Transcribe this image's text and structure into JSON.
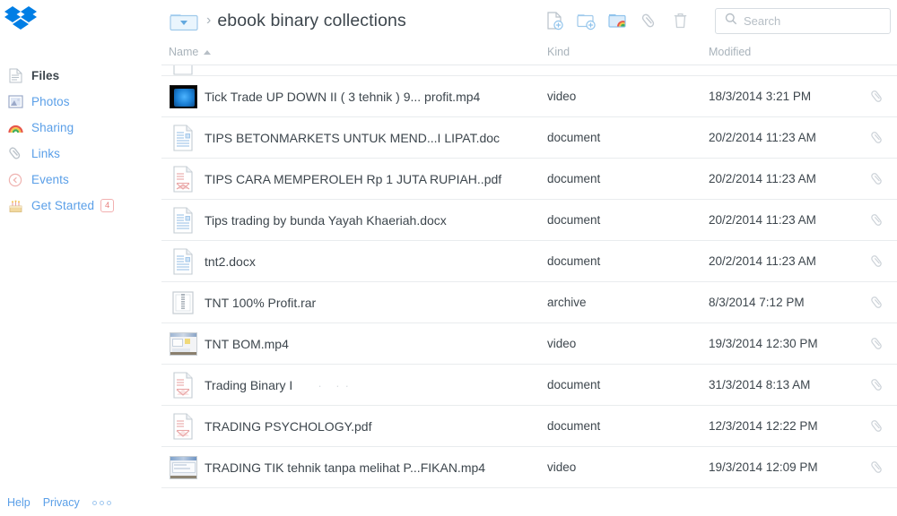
{
  "app": {
    "name": "Dropbox",
    "logo_icon": "dropbox-logo-icon"
  },
  "sidebar": {
    "items": [
      {
        "label": "Files",
        "icon": "files-icon",
        "active": true,
        "badge": null
      },
      {
        "label": "Photos",
        "icon": "photos-icon",
        "active": false,
        "badge": null
      },
      {
        "label": "Sharing",
        "icon": "sharing-icon",
        "active": false,
        "badge": null
      },
      {
        "label": "Links",
        "icon": "links-icon",
        "active": false,
        "badge": null
      },
      {
        "label": "Events",
        "icon": "events-icon",
        "active": false,
        "badge": null
      },
      {
        "label": "Get Started",
        "icon": "get-started-icon",
        "active": false,
        "badge": "4"
      }
    ],
    "footer": {
      "help": "Help",
      "privacy": "Privacy",
      "more_icon": "more-dots-icon"
    }
  },
  "header": {
    "folder_icon": "folder-dropdown-icon",
    "separator": "›",
    "breadcrumb": "ebook binary collections",
    "tools": [
      {
        "name": "upload-file-button",
        "icon": "file-plus-icon"
      },
      {
        "name": "new-folder-button",
        "icon": "folder-plus-icon"
      },
      {
        "name": "share-folder-button",
        "icon": "shared-folder-icon"
      },
      {
        "name": "get-link-button",
        "icon": "paperclip-icon"
      },
      {
        "name": "delete-button",
        "icon": "trash-icon"
      }
    ],
    "search": {
      "placeholder": "Search",
      "value": "",
      "icon": "search-icon"
    }
  },
  "table": {
    "columns": [
      {
        "key": "name",
        "label": "Name",
        "sorted": true,
        "sort_dir": "asc"
      },
      {
        "key": "kind",
        "label": "Kind",
        "sorted": false
      },
      {
        "key": "modified",
        "label": "Modified",
        "sorted": false
      }
    ],
    "link_icon": "paperclip-icon",
    "rows": [
      {
        "name": "",
        "kind": "",
        "modified": "",
        "icon": "document-icon",
        "partial": true
      },
      {
        "name": "Tick Trade UP DOWN II ( 3 tehnik ) 9... profit.mp4",
        "kind": "video",
        "modified": "18/3/2014 3:21 PM",
        "icon": "video-thumbnail-dark"
      },
      {
        "name": "TIPS BETONMARKETS UNTUK MEND...I LIPAT.doc",
        "kind": "document",
        "modified": "20/2/2014 11:23 AM",
        "icon": "doc-icon"
      },
      {
        "name": "TIPS CARA MEMPEROLEH Rp 1 JUTA RUPIAH..pdf",
        "kind": "document",
        "modified": "20/2/2014 11:23 AM",
        "icon": "pdf-icon"
      },
      {
        "name": "Tips trading by bunda Yayah Khaeriah.docx",
        "kind": "document",
        "modified": "20/2/2014 11:23 AM",
        "icon": "doc-icon"
      },
      {
        "name": "tnt2.docx",
        "kind": "document",
        "modified": "20/2/2014 11:23 AM",
        "icon": "doc-icon"
      },
      {
        "name": "TNT 100% Profit.rar",
        "kind": "archive",
        "modified": "8/3/2014 7:12 PM",
        "icon": "archive-icon"
      },
      {
        "name": "TNT BOM.mp4",
        "kind": "video",
        "modified": "19/3/2014 12:30 PM",
        "icon": "video-thumbnail-light"
      },
      {
        "name": "Trading Binary I",
        "name_fragment": "·  ··",
        "kind": "document",
        "modified": "31/3/2014 8:13 AM",
        "icon": "pdf-icon",
        "partially_rendered": true
      },
      {
        "name": "TRADING PSYCHOLOGY.pdf",
        "kind": "document",
        "modified": "12/3/2014 12:22 PM",
        "icon": "pdf-icon"
      },
      {
        "name": "TRADING TIK tehnik tanpa melihat P...FIKAN.mp4",
        "kind": "video",
        "modified": "19/3/2014 12:09 PM",
        "icon": "video-thumbnail-light"
      }
    ]
  },
  "colors": {
    "brand_blue": "#007ee5",
    "link_blue": "#5a9fe8",
    "text": "#3d464d",
    "muted": "#a9b3bb",
    "border": "#e9ecee",
    "badge_red": "#e8807f"
  }
}
